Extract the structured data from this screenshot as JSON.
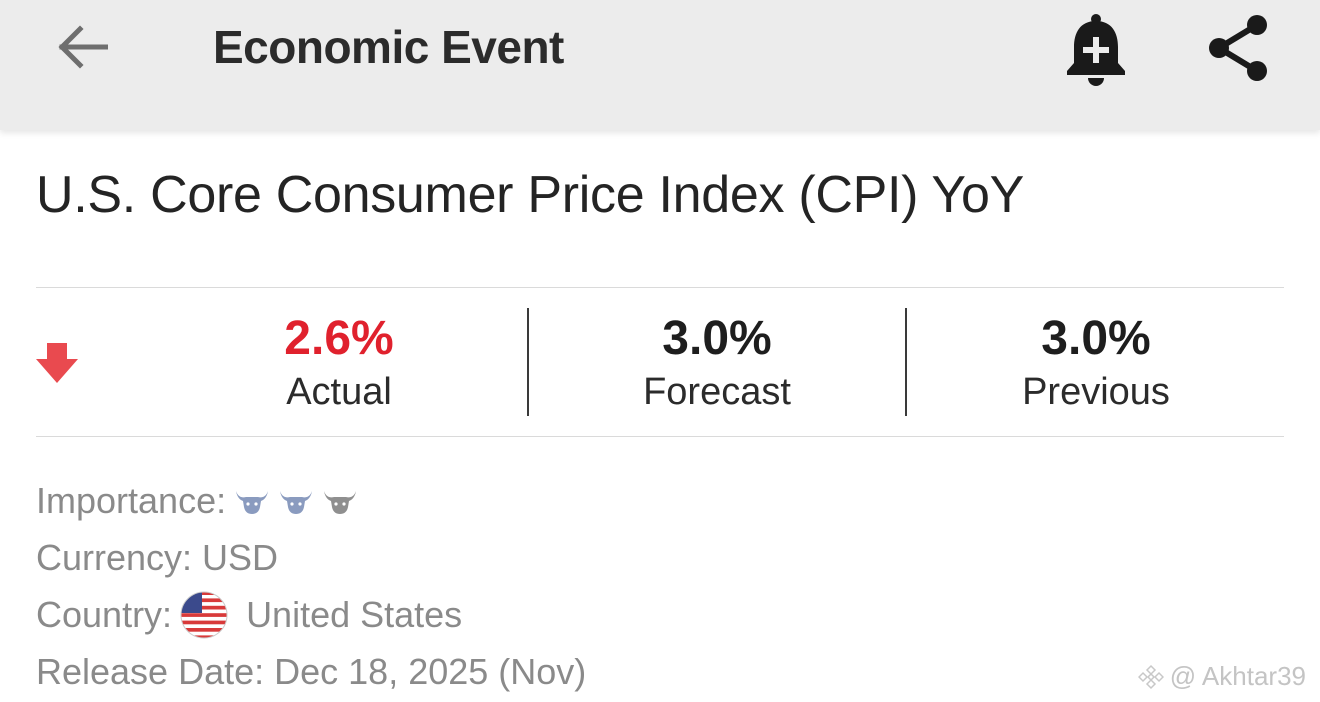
{
  "topbar": {
    "title": "Economic Event",
    "back_icon": "arrow-left-icon",
    "bell_icon": "bell-plus-icon",
    "share_icon": "share-icon"
  },
  "event": {
    "title": "U.S. Core Consumer Price Index (CPI) YoY",
    "trend": "down",
    "trend_color": "#e0212d"
  },
  "stats": {
    "actual": {
      "value": "2.6%",
      "label": "Actual",
      "color": "#e0212d"
    },
    "forecast": {
      "value": "3.0%",
      "label": "Forecast"
    },
    "previous": {
      "value": "3.0%",
      "label": "Previous"
    }
  },
  "info": {
    "importance_label": "Importance:",
    "importance_level": 2,
    "importance_max": 3,
    "currency_label": "Currency:",
    "currency_value": "USD",
    "country_label": "Country:",
    "country_value": "United States",
    "release_label": "Release Date:",
    "release_value": "Dec 18, 2025 (Nov)"
  },
  "watermark": {
    "text": "@ Akhtar39"
  }
}
